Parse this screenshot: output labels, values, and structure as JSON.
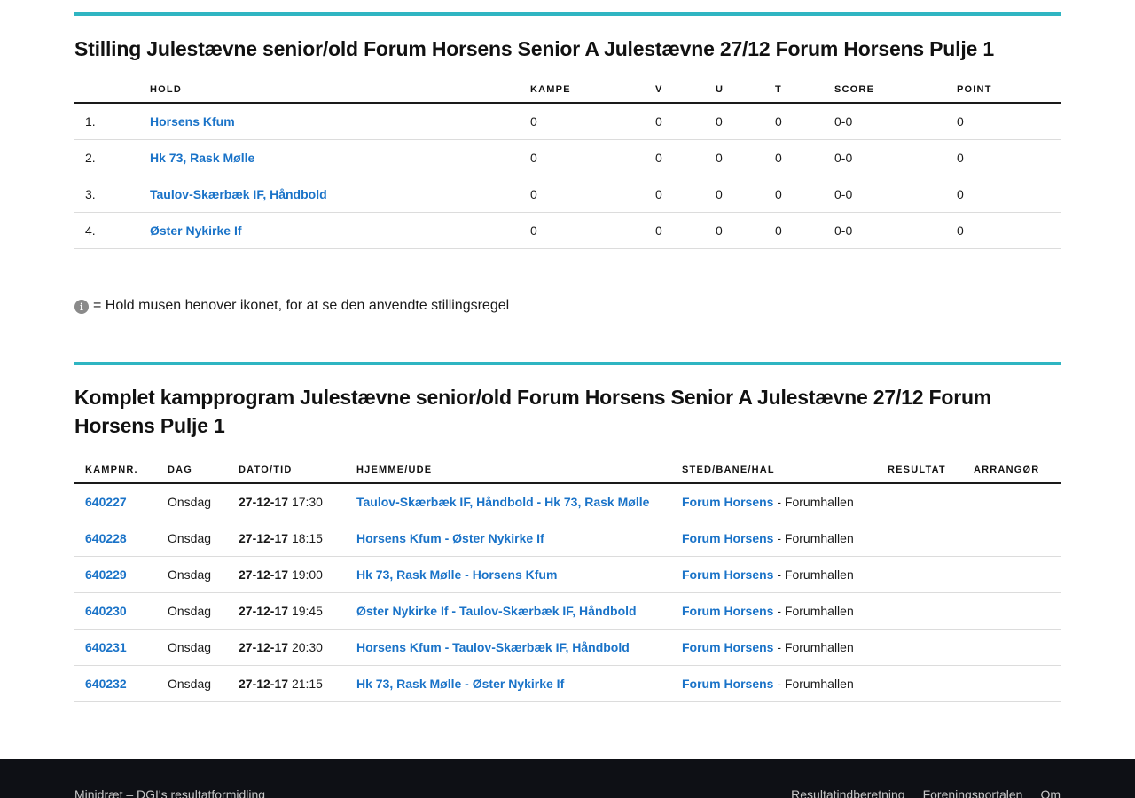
{
  "standings": {
    "title": "Stilling Julestævne senior/old Forum Horsens Senior A Julestævne 27/12 Forum Horsens Pulje 1",
    "headers": [
      "",
      "HOLD",
      "KAMPE",
      "V",
      "U",
      "T",
      "SCORE",
      "POINT"
    ],
    "rows": [
      {
        "pos": "1.",
        "team": "Horsens Kfum",
        "kampe": "0",
        "v": "0",
        "u": "0",
        "t": "0",
        "score": "0-0",
        "point": "0"
      },
      {
        "pos": "2.",
        "team": "Hk 73, Rask Mølle",
        "kampe": "0",
        "v": "0",
        "u": "0",
        "t": "0",
        "score": "0-0",
        "point": "0"
      },
      {
        "pos": "3.",
        "team": "Taulov-Skærbæk IF, Håndbold",
        "kampe": "0",
        "v": "0",
        "u": "0",
        "t": "0",
        "score": "0-0",
        "point": "0"
      },
      {
        "pos": "4.",
        "team": "Øster Nykirke If",
        "kampe": "0",
        "v": "0",
        "u": "0",
        "t": "0",
        "score": "0-0",
        "point": "0"
      }
    ]
  },
  "note": {
    "icon": "info-icon",
    "text": "= Hold musen henover ikonet, for at se den anvendte stillingsregel"
  },
  "program": {
    "title": "Komplet kampprogram Julestævne senior/old Forum Horsens Senior A Julestævne 27/12 Forum Horsens Pulje 1",
    "headers": [
      "KAMPNR.",
      "DAG",
      "DATO/TID",
      "HJEMME/UDE",
      "STED/BANE/HAL",
      "RESULTAT",
      "ARRANGØR"
    ],
    "rows": [
      {
        "nr": "640227",
        "dag": "Onsdag",
        "date": "27-12-17",
        "time": "17:30",
        "home": "Taulov-Skærbæk IF, Håndbold",
        "away": "Hk 73, Rask Mølle",
        "venue": "Forum Horsens",
        "hall": "Forumhallen",
        "result": "",
        "org": ""
      },
      {
        "nr": "640228",
        "dag": "Onsdag",
        "date": "27-12-17",
        "time": "18:15",
        "home": "Horsens Kfum",
        "away": "Øster Nykirke If",
        "venue": "Forum Horsens",
        "hall": "Forumhallen",
        "result": "",
        "org": ""
      },
      {
        "nr": "640229",
        "dag": "Onsdag",
        "date": "27-12-17",
        "time": "19:00",
        "home": "Hk 73, Rask Mølle",
        "away": "Horsens Kfum",
        "venue": "Forum Horsens",
        "hall": "Forumhallen",
        "result": "",
        "org": ""
      },
      {
        "nr": "640230",
        "dag": "Onsdag",
        "date": "27-12-17",
        "time": "19:45",
        "home": "Øster Nykirke If",
        "away": "Taulov-Skærbæk IF, Håndbold",
        "venue": "Forum Horsens",
        "hall": "Forumhallen",
        "result": "",
        "org": ""
      },
      {
        "nr": "640231",
        "dag": "Onsdag",
        "date": "27-12-17",
        "time": "20:30",
        "home": "Horsens Kfum",
        "away": "Taulov-Skærbæk IF, Håndbold",
        "venue": "Forum Horsens",
        "hall": "Forumhallen",
        "result": "",
        "org": ""
      },
      {
        "nr": "640232",
        "dag": "Onsdag",
        "date": "27-12-17",
        "time": "21:15",
        "home": "Hk 73, Rask Mølle",
        "away": "Øster Nykirke If",
        "venue": "Forum Horsens",
        "hall": "Forumhallen",
        "result": "",
        "org": ""
      }
    ]
  },
  "footer": {
    "left": "Minidræt – DGI's resultatformidling",
    "links": [
      "Resultatindberetning",
      "Foreningsportalen",
      "Om"
    ]
  },
  "colors": {
    "accent": "#2fb5c2",
    "link": "#1a73c8",
    "footer_bg": "#0e1015"
  }
}
